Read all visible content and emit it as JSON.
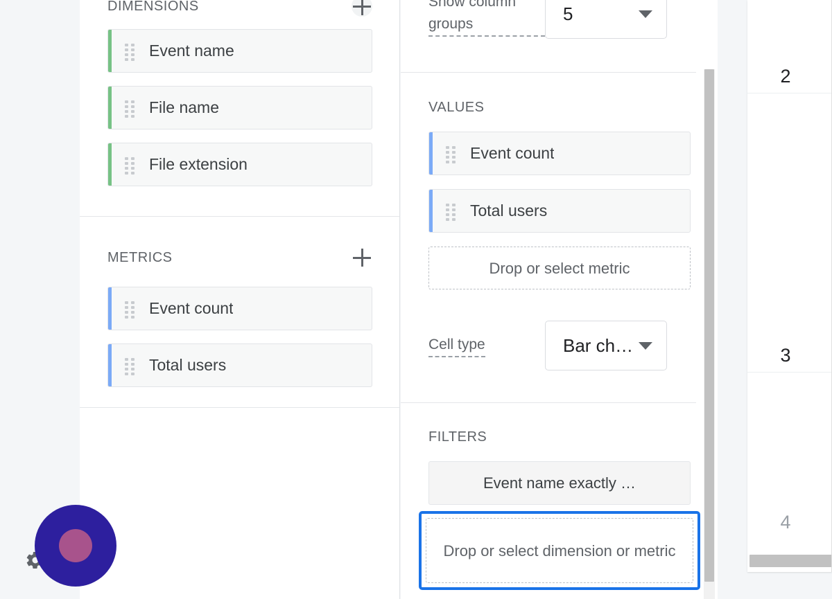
{
  "variables_panel": {
    "dimensions": {
      "title": "DIMENSIONS",
      "add_icon": "plus-icon",
      "items": [
        {
          "label": "Event name",
          "drag_icon": "drag-handle-icon"
        },
        {
          "label": "File name",
          "drag_icon": "drag-handle-icon"
        },
        {
          "label": "File extension",
          "drag_icon": "drag-handle-icon"
        }
      ]
    },
    "metrics": {
      "title": "METRICS",
      "add_icon": "plus-icon",
      "items": [
        {
          "label": "Event count",
          "drag_icon": "drag-handle-icon"
        },
        {
          "label": "Total users",
          "drag_icon": "drag-handle-icon"
        }
      ]
    }
  },
  "settings_panel": {
    "show_column_groups": {
      "label": "Show column groups",
      "value": "5",
      "caret_icon": "chevron-down-icon"
    },
    "values": {
      "title": "VALUES",
      "items": [
        {
          "label": "Event count",
          "drag_icon": "drag-handle-icon"
        },
        {
          "label": "Total users",
          "drag_icon": "drag-handle-icon"
        }
      ],
      "dropzone": "Drop or select metric"
    },
    "cell_type": {
      "label": "Cell type",
      "value": "Bar ch…",
      "caret_icon": "chevron-down-icon"
    },
    "filters": {
      "title": "FILTERS",
      "items": [
        {
          "label": "Event name exactly …"
        }
      ],
      "dropzone": "Drop or select dimension or metric",
      "focused": true
    }
  },
  "canvas_panel": {
    "rows": [
      {
        "number": "2",
        "muted": false
      },
      {
        "number": "3",
        "muted": false
      },
      {
        "number": "4",
        "muted": true
      }
    ]
  },
  "overlay": {
    "gear_icon": "gear-icon",
    "click_indicator": "click-indicator"
  },
  "colors": {
    "dimension_accent": "#77c285",
    "metric_accent": "#7baaf7",
    "focus_ring": "#1a73e8",
    "click_outer": "#2d1f9e",
    "click_inner": "#a8538c",
    "page_background": "#f4f6f8"
  }
}
